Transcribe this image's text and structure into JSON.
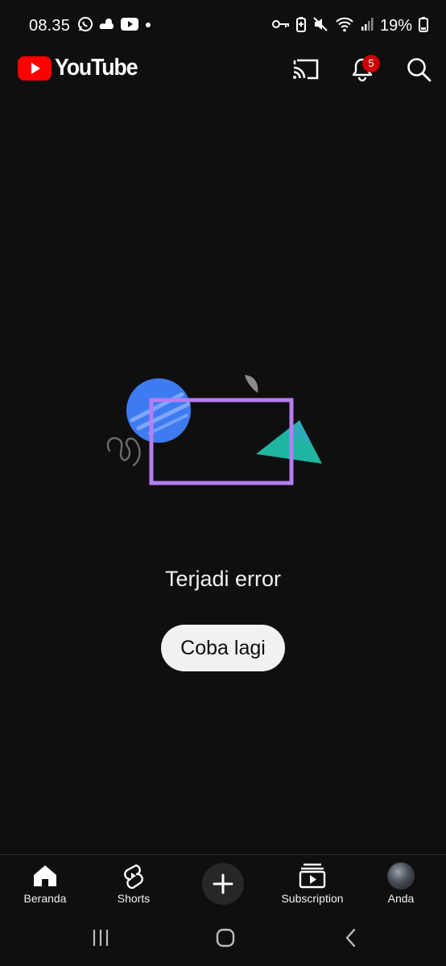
{
  "status_bar": {
    "time": "08.35",
    "battery_percent": "19%",
    "left_icons": [
      "whatsapp-icon",
      "weather-icon",
      "youtube-icon",
      "dot-icon"
    ],
    "right_icons": [
      "key-icon",
      "battery-saver-icon",
      "mute-icon",
      "wifi-icon",
      "signal-icon",
      "battery-icon"
    ]
  },
  "header": {
    "logo_text": "YouTube",
    "notification_count": "5"
  },
  "main": {
    "error_message": "Terjadi error",
    "retry_label": "Coba lagi"
  },
  "bottom_nav": {
    "items": [
      {
        "label": "Beranda",
        "icon": "home-icon"
      },
      {
        "label": "Shorts",
        "icon": "shorts-icon"
      },
      {
        "label": "",
        "icon": "plus-icon"
      },
      {
        "label": "Subscription",
        "icon": "subscriptions-icon"
      },
      {
        "label": "Anda",
        "icon": "avatar"
      }
    ]
  },
  "colors": {
    "background": "#0f0f0f",
    "brand_red": "#ff0000",
    "badge_red": "#cc0000",
    "button_bg": "#f1f1f1",
    "illustration_blue": "#3e7bf0",
    "illustration_purple": "#b77df5",
    "illustration_teal": "#1fb5a0"
  }
}
